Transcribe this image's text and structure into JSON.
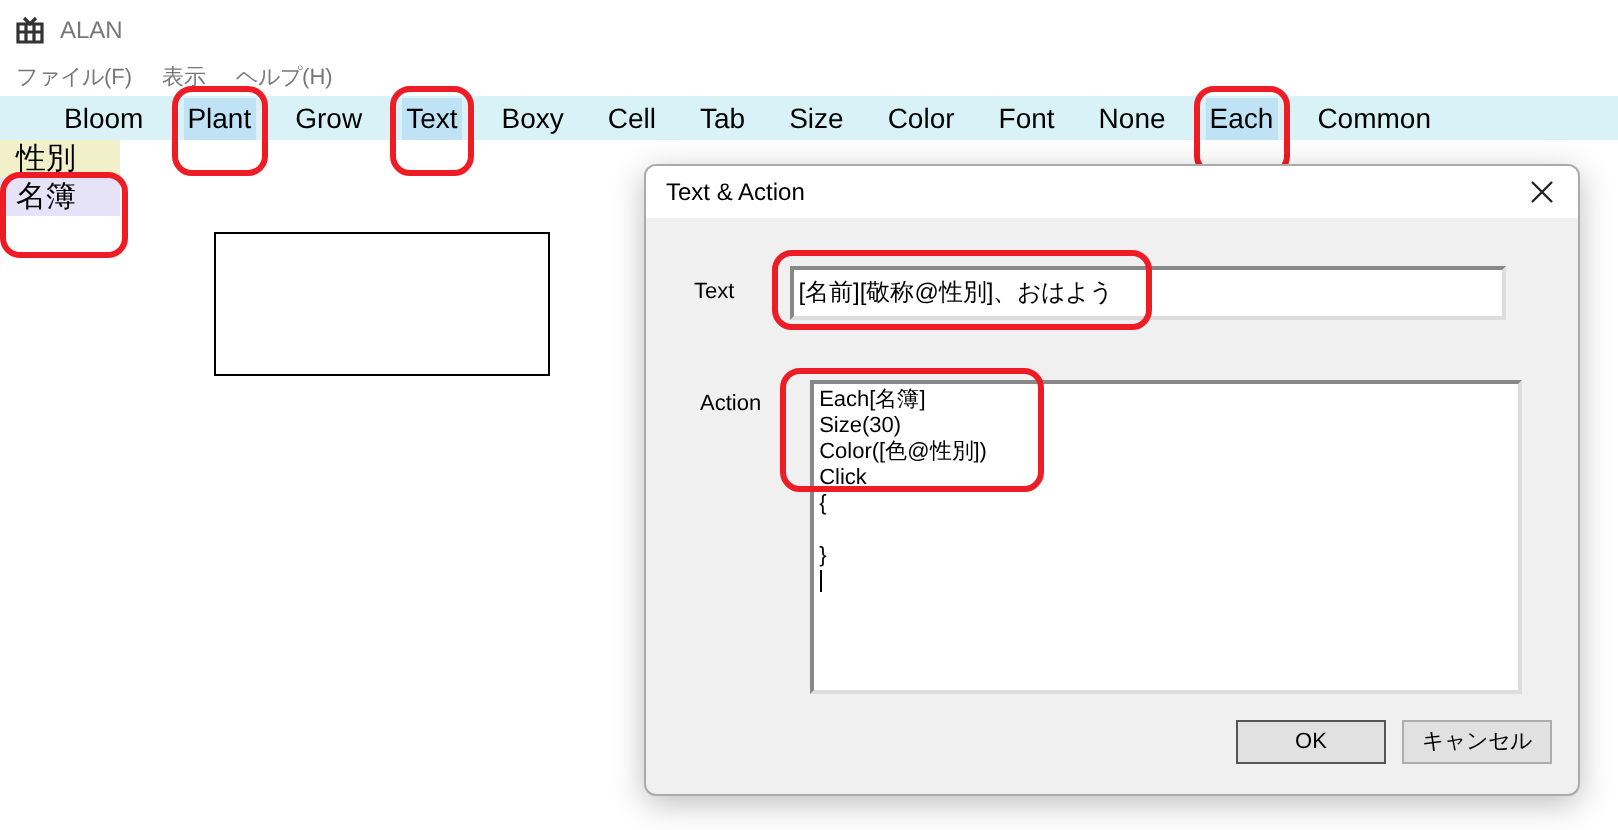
{
  "window": {
    "title": "ALAN"
  },
  "menu": [
    "ファイル(F)",
    "表示",
    "ヘルプ(H)"
  ],
  "toolbar": [
    {
      "label": "Bloom",
      "selected": false
    },
    {
      "label": "Plant",
      "selected": true
    },
    {
      "label": "Grow",
      "selected": false
    },
    {
      "label": "Text",
      "selected": true
    },
    {
      "label": "Boxy",
      "selected": false
    },
    {
      "label": "Cell",
      "selected": false
    },
    {
      "label": "Tab",
      "selected": false
    },
    {
      "label": "Size",
      "selected": false
    },
    {
      "label": "Color",
      "selected": false
    },
    {
      "label": "Font",
      "selected": false
    },
    {
      "label": "None",
      "selected": false
    },
    {
      "label": "Each",
      "selected": true
    },
    {
      "label": "Common",
      "selected": false
    }
  ],
  "sidebar": {
    "items": [
      {
        "label": "性別",
        "color": "#f2f0c8"
      },
      {
        "label": "名簿",
        "color": "#e6e2f8"
      }
    ]
  },
  "dialog": {
    "title": "Text & Action",
    "text_label": "Text",
    "text_value": "[名前][敬称@性別]、おはよう",
    "action_label": "Action",
    "action_lines": [
      {
        "text": "Each[名簿]",
        "blank_after": false
      },
      {
        "text": "Size(30)",
        "blank_after": false
      },
      {
        "text": "Color([色@性別])",
        "blank_after": false
      },
      {
        "text": "Click",
        "blank_after": false
      },
      {
        "text": "{",
        "blank_after": true
      },
      {
        "text": "}",
        "blank_after": false
      }
    ],
    "buttons": [
      "OK",
      "キャンセル"
    ]
  }
}
